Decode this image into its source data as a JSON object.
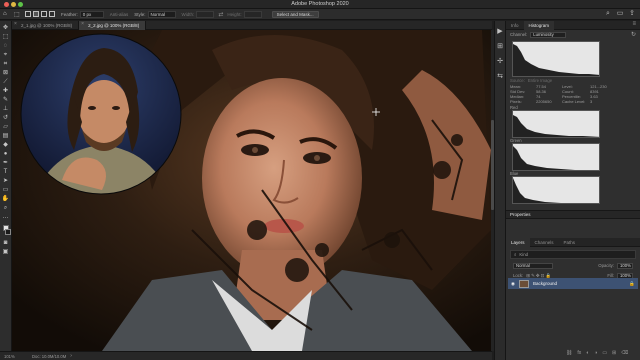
{
  "app_title": "Adobe Photoshop 2020",
  "options_bar": {
    "feather_label": "Feather:",
    "feather_value": "0 px",
    "antialias_label": "Anti-alias",
    "style_label": "Style:",
    "style_value": "Normal",
    "width_label": "Width:",
    "height_label": "Height:",
    "select_mask_label": "Select and Mask..."
  },
  "tabs": [
    {
      "label": "2_1.jpg @ 100% (RGB/8)"
    },
    {
      "label": "2_2.jpg @ 100% (RGB/8)"
    }
  ],
  "status": {
    "zoom": "101%",
    "doc": "Doc: 10.0M/10.0M"
  },
  "histogram_panel": {
    "tabs": [
      "Info",
      "Histogram"
    ],
    "channel_label": "Channel:",
    "channel_value": "Luminosity",
    "source_label": "Source:",
    "source_value": "Entire Image",
    "stats": [
      [
        "Mean:",
        "77.54",
        "Level:",
        "121...230"
      ],
      [
        "Std Dev:",
        "58.36",
        "Count:",
        "8391"
      ],
      [
        "Median:",
        "74",
        "Percentile:",
        "3.63"
      ],
      [
        "Pixels:",
        "2205650",
        "Cache Level:",
        "3"
      ]
    ],
    "channels": [
      "Red",
      "Green",
      "Blue"
    ]
  },
  "properties": {
    "label": "Properties"
  },
  "layers_panel": {
    "tabs": [
      "Layers",
      "Channels",
      "Paths"
    ],
    "kind_label": "Kind",
    "blend_mode": "Normal",
    "opacity_label": "Opacity:",
    "opacity_value": "100%",
    "lock_label": "Lock:",
    "fill_label": "Fill:",
    "fill_value": "100%",
    "layer_name": "Background"
  },
  "colors": {
    "accent": "#3d5273",
    "panel": "#2f2f2f"
  }
}
